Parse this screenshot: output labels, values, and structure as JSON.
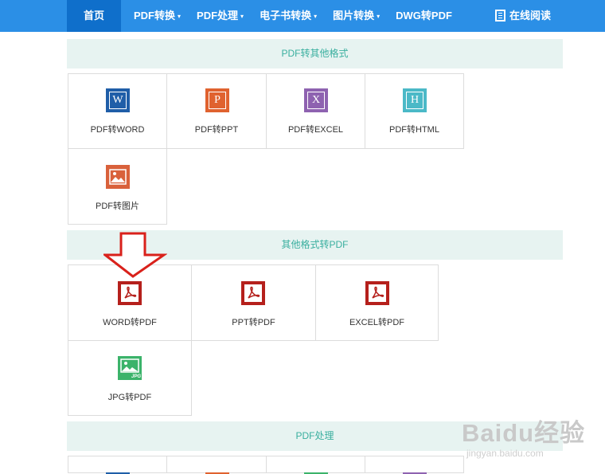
{
  "nav": {
    "items": [
      {
        "label": "首页",
        "caret": ""
      },
      {
        "label": "PDF转换",
        "caret": "▾"
      },
      {
        "label": "PDF处理",
        "caret": "▾"
      },
      {
        "label": "电子书转换",
        "caret": "▾"
      },
      {
        "label": "图片转换",
        "caret": "▾"
      },
      {
        "label": "DWG转PDF",
        "caret": ""
      }
    ],
    "reader_label": "在线阅读"
  },
  "sections": {
    "s1": {
      "title": "PDF转其他格式",
      "tiles": [
        {
          "label": "PDF转WORD",
          "icon": "word-icon",
          "letter": "W"
        },
        {
          "label": "PDF转PPT",
          "icon": "ppt-icon",
          "letter": "P"
        },
        {
          "label": "PDF转EXCEL",
          "icon": "excel-icon",
          "letter": "X"
        },
        {
          "label": "PDF转HTML",
          "icon": "html-icon",
          "letter": "H"
        },
        {
          "label": "PDF转图片",
          "icon": "image-icon",
          "letter": ""
        }
      ]
    },
    "s2": {
      "title": "其他格式转PDF",
      "tiles": [
        {
          "label": "WORD转PDF",
          "icon": "pdf-icon"
        },
        {
          "label": "PPT转PDF",
          "icon": "pdf-icon"
        },
        {
          "label": "EXCEL转PDF",
          "icon": "pdf-icon"
        },
        {
          "label": "JPG转PDF",
          "icon": "jpg-icon",
          "badge": "JPG"
        }
      ]
    },
    "s3": {
      "title": "PDF处理"
    }
  },
  "colors": {
    "nav_bg": "#2b8fe6",
    "nav_active": "#0f6fcb",
    "section_bg": "#e7f3f1",
    "section_text": "#3aaf9f",
    "word": "#1f5ea8",
    "ppt": "#e0622f",
    "excel": "#8e62b0",
    "html": "#4bb9c7",
    "image": "#d9613b",
    "pdf": "#b5201c",
    "jpg": "#3bb36a",
    "arrow": "#d9211b"
  },
  "watermark": {
    "brand": "Baidu经验",
    "url": "jingyan.baidu.com"
  }
}
